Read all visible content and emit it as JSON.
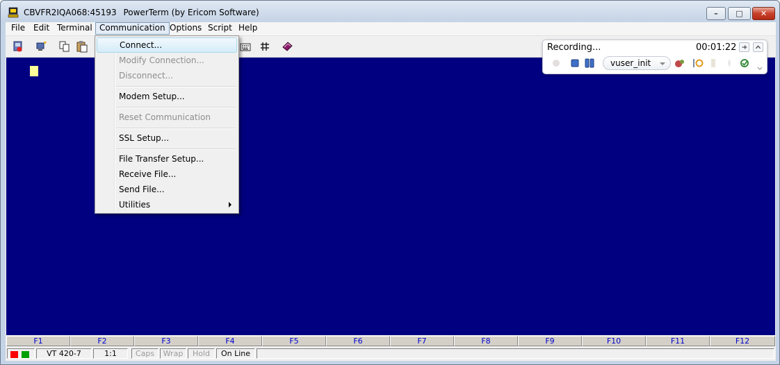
{
  "window": {
    "session_name": "CBVFR2IQA068:45193",
    "app_title": "PowerTerm (by Ericom Software)",
    "controls": {
      "minimize": "–",
      "maximize": "□",
      "close": "✕"
    }
  },
  "menubar": {
    "items": [
      "File",
      "Edit",
      "Terminal",
      "Communication",
      "Options",
      "Script",
      "Help"
    ],
    "active": "Communication"
  },
  "toolbar": {
    "icons": [
      "disconnect-icon",
      "new-session-icon",
      "copy-icon",
      "paste-icon",
      "keyboard-icon",
      "grid-icon",
      "book-icon"
    ]
  },
  "communication_menu": {
    "items": [
      {
        "label": "Connect...",
        "enabled": true
      },
      {
        "label": "Modify Connection...",
        "enabled": false
      },
      {
        "label": "Disconnect...",
        "enabled": false
      },
      {
        "label": "Modem Setup...",
        "enabled": true
      },
      {
        "label": "Reset Communication",
        "enabled": false
      },
      {
        "label": "SSL Setup...",
        "enabled": true
      },
      {
        "label": "File Transfer Setup...",
        "enabled": true
      },
      {
        "label": "Receive File...",
        "enabled": true
      },
      {
        "label": "Send File...",
        "enabled": true
      },
      {
        "label": "Utilities",
        "enabled": true,
        "has_submenu": true
      }
    ]
  },
  "recording": {
    "status": "Recording...",
    "elapsed": "00:01:22",
    "action": "vuser_init"
  },
  "function_keys": [
    "F1",
    "F2",
    "F3",
    "F4",
    "F5",
    "F6",
    "F7",
    "F8",
    "F9",
    "F10",
    "F11",
    "F12"
  ],
  "statusbar": {
    "terminal_type": "VT 420-7",
    "session_index": "1:1",
    "caps": "Caps",
    "wrap": "Wrap",
    "hold": "Hold",
    "line_state": "On Line"
  },
  "colors": {
    "terminal_background": "#000080",
    "cursor": "#ffff99",
    "led_red": "#ff0000",
    "led_green": "#00a000"
  }
}
